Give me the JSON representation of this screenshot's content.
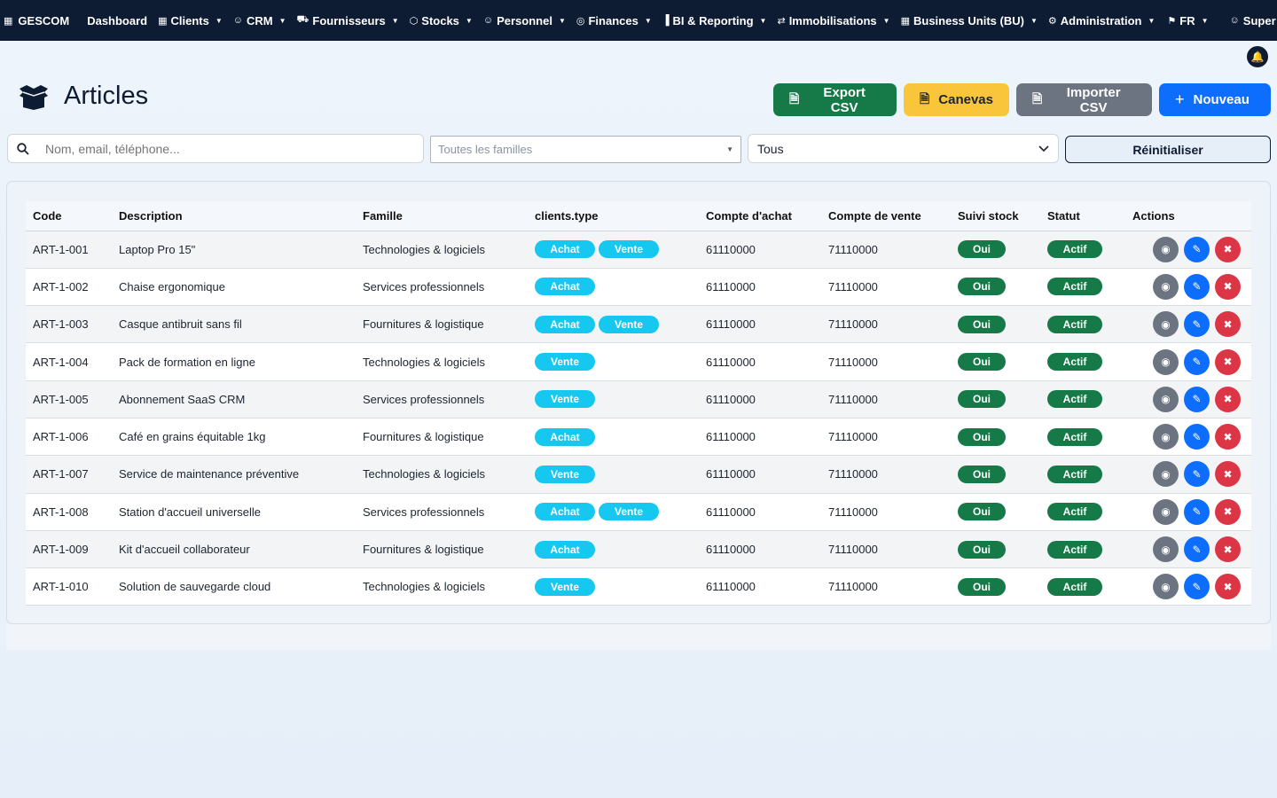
{
  "nav": {
    "brand": "GESCOM",
    "items": [
      {
        "label": "Dashboard",
        "icon": "none",
        "caret": false
      },
      {
        "label": "Clients",
        "icon": "building-icon",
        "caret": true
      },
      {
        "label": "CRM",
        "icon": "people-icon",
        "caret": true
      },
      {
        "label": "Fournisseurs",
        "icon": "truck-icon",
        "caret": true
      },
      {
        "label": "Stocks",
        "icon": "box-icon",
        "caret": true
      },
      {
        "label": "Personnel",
        "icon": "person-icon",
        "caret": true
      },
      {
        "label": "Finances",
        "icon": "coins-icon",
        "caret": true
      },
      {
        "label": "BI & Reporting",
        "icon": "bar-chart-icon",
        "caret": true
      },
      {
        "label": "Immobilisations",
        "icon": "transfer-icon",
        "caret": true
      },
      {
        "label": "Business Units (BU)",
        "icon": "building-icon",
        "caret": true
      },
      {
        "label": "Administration",
        "icon": "gear-icon",
        "caret": true
      }
    ],
    "language": "FR",
    "user": "Super Admin"
  },
  "page": {
    "title": "Articles"
  },
  "toolbar": {
    "export": "Export CSV",
    "canevas": "Canevas",
    "import": "Importer CSV",
    "new": "Nouveau"
  },
  "filters": {
    "search_placeholder": "Nom, email, téléphone...",
    "family_placeholder": "Toutes les familles",
    "type_value": "Tous",
    "reset": "Réinitialiser"
  },
  "table": {
    "columns": [
      "Code",
      "Description",
      "Famille",
      "clients.type",
      "Compte d'achat",
      "Compte de vente",
      "Suivi stock",
      "Statut",
      "Actions"
    ],
    "rows": [
      {
        "code": "ART-1-001",
        "description": "Laptop Pro 15\"",
        "famille": "Technologies & logiciels",
        "types": [
          "Achat",
          "Vente"
        ],
        "compte_achat": "61110000",
        "compte_vente": "71110000",
        "suivi": "Oui",
        "statut": "Actif"
      },
      {
        "code": "ART-1-002",
        "description": "Chaise ergonomique",
        "famille": "Services professionnels",
        "types": [
          "Achat"
        ],
        "compte_achat": "61110000",
        "compte_vente": "71110000",
        "suivi": "Oui",
        "statut": "Actif"
      },
      {
        "code": "ART-1-003",
        "description": "Casque antibruit sans fil",
        "famille": "Fournitures & logistique",
        "types": [
          "Achat",
          "Vente"
        ],
        "compte_achat": "61110000",
        "compte_vente": "71110000",
        "suivi": "Oui",
        "statut": "Actif"
      },
      {
        "code": "ART-1-004",
        "description": "Pack de formation en ligne",
        "famille": "Technologies & logiciels",
        "types": [
          "Vente"
        ],
        "compte_achat": "61110000",
        "compte_vente": "71110000",
        "suivi": "Oui",
        "statut": "Actif"
      },
      {
        "code": "ART-1-005",
        "description": "Abonnement SaaS CRM",
        "famille": "Services professionnels",
        "types": [
          "Vente"
        ],
        "compte_achat": "61110000",
        "compte_vente": "71110000",
        "suivi": "Oui",
        "statut": "Actif"
      },
      {
        "code": "ART-1-006",
        "description": "Café en grains équitable 1kg",
        "famille": "Fournitures & logistique",
        "types": [
          "Achat"
        ],
        "compte_achat": "61110000",
        "compte_vente": "71110000",
        "suivi": "Oui",
        "statut": "Actif"
      },
      {
        "code": "ART-1-007",
        "description": "Service de maintenance préventive",
        "famille": "Technologies & logiciels",
        "types": [
          "Vente"
        ],
        "compte_achat": "61110000",
        "compte_vente": "71110000",
        "suivi": "Oui",
        "statut": "Actif"
      },
      {
        "code": "ART-1-008",
        "description": "Station d'accueil universelle",
        "famille": "Services professionnels",
        "types": [
          "Achat",
          "Vente"
        ],
        "compte_achat": "61110000",
        "compte_vente": "71110000",
        "suivi": "Oui",
        "statut": "Actif"
      },
      {
        "code": "ART-1-009",
        "description": "Kit d'accueil collaborateur",
        "famille": "Fournitures & logistique",
        "types": [
          "Achat"
        ],
        "compte_achat": "61110000",
        "compte_vente": "71110000",
        "suivi": "Oui",
        "statut": "Actif"
      },
      {
        "code": "ART-1-010",
        "description": "Solution de sauvegarde cloud",
        "famille": "Technologies & logiciels",
        "types": [
          "Vente"
        ],
        "compte_achat": "61110000",
        "compte_vente": "71110000",
        "suivi": "Oui",
        "statut": "Actif"
      }
    ]
  },
  "colors": {
    "navbar": "#0d1b33",
    "type_pill": "#16c7ef",
    "status_green": "#157a47",
    "primary": "#0d6efd",
    "danger": "#dc3545",
    "warning": "#f9c53a"
  }
}
